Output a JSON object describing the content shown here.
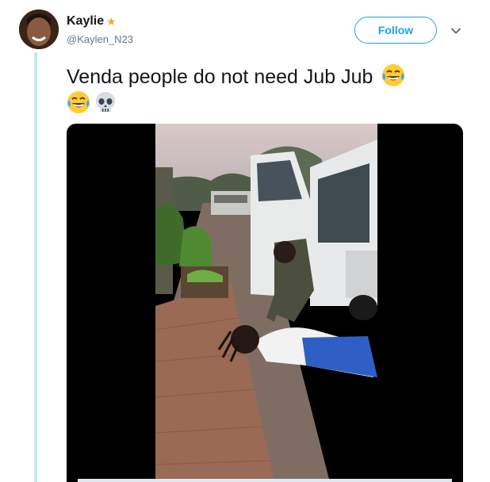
{
  "user": {
    "display_name": "Kaylie",
    "handle": "@Kaylen_N23",
    "badge_icon": "sparkle-star-icon"
  },
  "actions": {
    "follow_label": "Follow",
    "more_icon": "chevron-down-icon"
  },
  "tweet": {
    "text": "Venda people do not need Jub Jub",
    "emojis": [
      "face-with-tears-of-joy-icon",
      "face-with-tears-of-joy-icon",
      "skull-icon"
    ]
  },
  "media": {
    "type": "video",
    "content": "roadside-scene-video-frame"
  },
  "colors": {
    "accent": "#1da1f2",
    "thread_line": "#c4e7fb",
    "text_primary": "#14171a",
    "text_secondary": "#657786"
  }
}
